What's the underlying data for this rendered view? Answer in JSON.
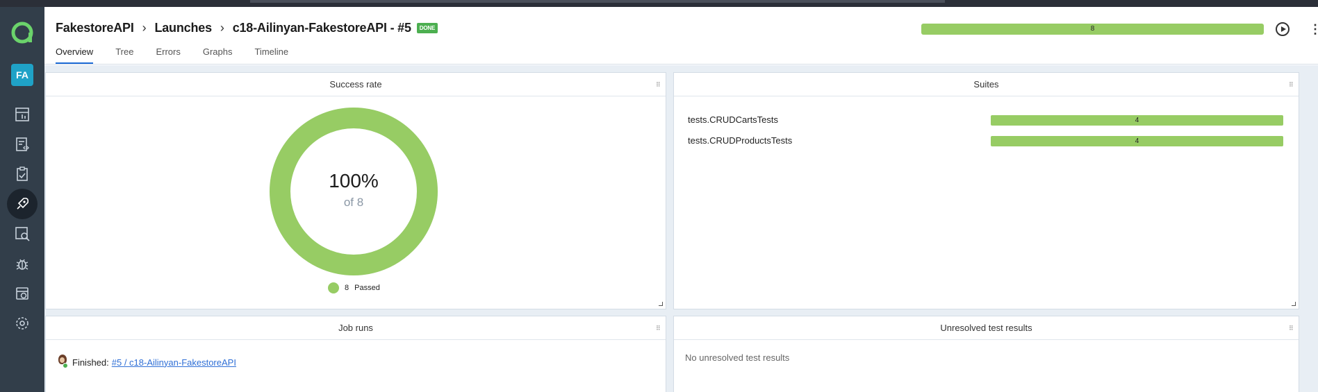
{
  "sidebar": {
    "logo": "allure-logo-icon",
    "avatar_initials": "FA",
    "items": [
      {
        "icon": "dashboard-icon"
      },
      {
        "icon": "test-cases-icon"
      },
      {
        "icon": "test-plans-icon"
      },
      {
        "icon": "launches-icon",
        "active": true
      },
      {
        "icon": "analytics-icon"
      },
      {
        "icon": "defects-icon"
      },
      {
        "icon": "jobs-icon"
      },
      {
        "icon": "settings-icon"
      }
    ]
  },
  "header": {
    "breadcrumb": [
      "FakestoreAPI",
      "Launches",
      "c18-Ailinyan-FakestoreAPI - #5"
    ],
    "status_badge": "DONE",
    "progress_total": "8",
    "tabs": [
      "Overview",
      "Tree",
      "Errors",
      "Graphs",
      "Timeline"
    ],
    "active_tab": "Overview"
  },
  "widgets": {
    "success_rate": {
      "title": "Success rate",
      "percent_text": "100%",
      "of_text": "of 8",
      "legend_count": "8",
      "legend_label": "Passed",
      "passed_fraction": 1.0,
      "color": "#97cc64"
    },
    "suites": {
      "title": "Suites",
      "rows": [
        {
          "name": "tests.CRUDCartsTests",
          "count": "4"
        },
        {
          "name": "tests.CRUDProductsTests",
          "count": "4"
        }
      ]
    },
    "job_runs": {
      "title": "Job runs",
      "status_label": "Finished:",
      "link_text": "#5 / c18-Ailinyan-FakestoreAPI"
    },
    "unresolved": {
      "title": "Unresolved test results",
      "empty_text": "No unresolved test results"
    }
  }
}
